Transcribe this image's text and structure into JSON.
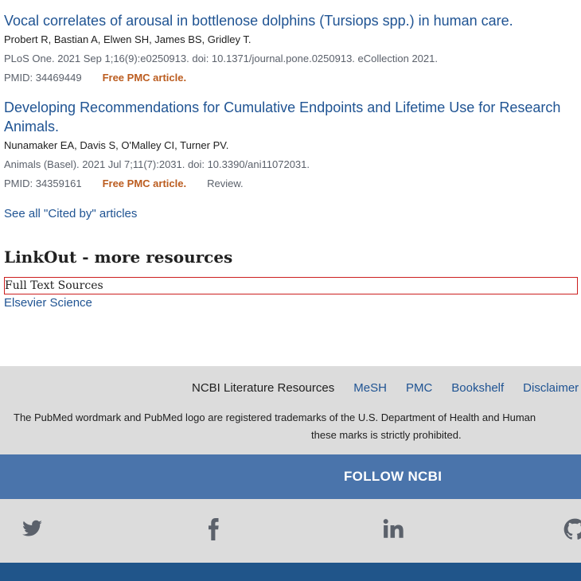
{
  "articles": [
    {
      "title": "Vocal correlates of arousal in bottlenose dolphins (Tursiops spp.) in human care.",
      "authors": "Probert R, Bastian A, Elwen SH, James BS, Gridley T.",
      "citation": "PLoS One. 2021 Sep 1;16(9):e0250913. doi: 10.1371/journal.pone.0250913. eCollection 2021.",
      "pmid": "PMID: 34469449",
      "free": "Free PMC article.",
      "review": ""
    },
    {
      "title": "Developing Recommendations for Cumulative Endpoints and Lifetime Use for Research Animals.",
      "authors": "Nunamaker EA, Davis S, O'Malley CI, Turner PV.",
      "citation": "Animals (Basel). 2021 Jul 7;11(7):2031. doi: 10.3390/ani11072031.",
      "pmid": "PMID: 34359161",
      "free": "Free PMC article.",
      "review": "Review."
    }
  ],
  "see_all": "See all \"Cited by\" articles",
  "linkout": {
    "heading": "LinkOut - more resources",
    "section": "Full Text Sources",
    "source": "Elsevier Science"
  },
  "footer": {
    "lit_resources": "NCBI Literature Resources",
    "links": [
      "MeSH",
      "PMC",
      "Bookshelf",
      "Disclaimer"
    ],
    "trademark_line1": "The PubMed wordmark and PubMed logo are registered trademarks of the U.S. Department of Health and Human",
    "trademark_line2": "these marks is strictly prohibited.",
    "follow": "FOLLOW NCBI",
    "social_icons": [
      "twitter-icon",
      "facebook-icon",
      "linkedin-icon",
      "github-icon"
    ]
  },
  "colors": {
    "link": "#205493",
    "free": "#bb5c1f",
    "follow_bg": "#4a74ab",
    "footer_bg": "#dcdcdc",
    "bottom_bar": "#20558a"
  }
}
